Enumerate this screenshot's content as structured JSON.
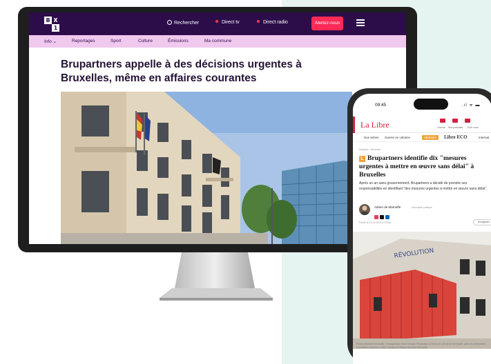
{
  "desktop": {
    "logo": {
      "tl": "B",
      "tr": "X",
      "br": "1"
    },
    "topbar": {
      "search_label": "Rechercher",
      "direct_tv": "Direct tv",
      "direct_radio": "Direct radio",
      "alert_button": "Alertez-nous"
    },
    "nav": [
      "Info ⌄",
      "Reportages",
      "Sport",
      "Culture",
      "Émissions",
      "Ma commune"
    ],
    "headline": "Brupartners appelle à des décisions urgentes à Bruxelles, même en affaires courantes",
    "colors": {
      "topbar": "#2c0d4a",
      "nav": "#f1c8ee",
      "alert": "#ff2a58",
      "live_dot": "#ff3b4d"
    }
  },
  "phone": {
    "status": {
      "time": "09:45",
      "icons": ".ıl ᯤ ▬"
    },
    "logo": "La Libre",
    "tools": [
      "Journal",
      "Nos podcasts",
      "Pour vous"
    ],
    "subnav": [
      "Nos séries",
      "Guerre en Ukraine",
      "Abonnez",
      "Libre ECO",
      "Internat"
    ],
    "breadcrumb": "Belgique  ›  Bruxelles",
    "badge": "L",
    "title": "Brupartners identifie dix \"mesures urgentes à mettre en œuvre sans délai\" à Bruxelles",
    "lead": "Après un an sans gouvernement, Brupartners a décidé de prendre ses responsabilités en identifiant \"des mesures urgentes à mettre en œuvre sans délai\".",
    "author": {
      "name": "Adrien de Marneffe",
      "role": "Journaliste politique"
    },
    "published": "Publié le 07-06-2025 à 07h56",
    "save_label": "Enregistrer",
    "caption": "Photos Bernard Demoulin. L'inauguration d'une fresque Révolution à l'écran du 110 de la rue Haute, avec les entreprises bruxelloises Vanesse, Geko, Dorland et Maison Bernard Demoulin",
    "colors": {
      "brand": "#d42040",
      "badge": "#f0a33c"
    }
  }
}
